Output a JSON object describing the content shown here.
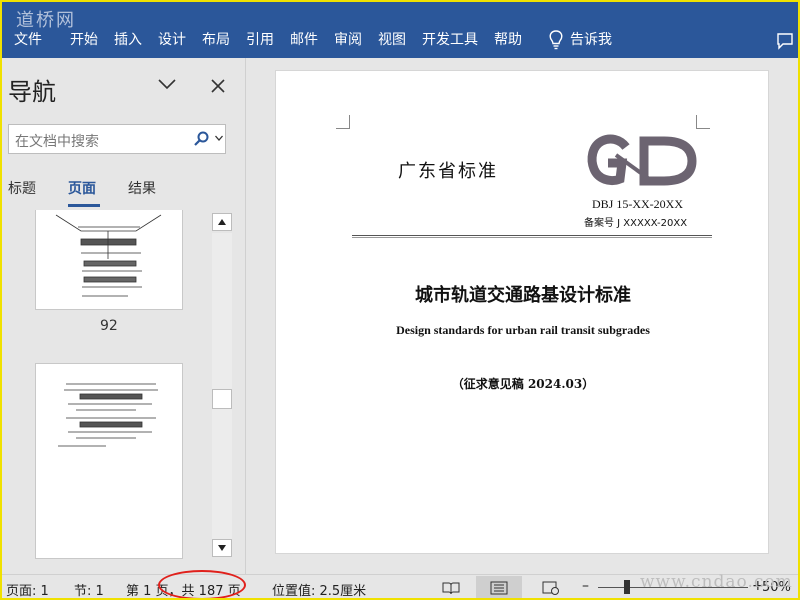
{
  "watermark": {
    "top": "道桥网",
    "bottom": "www.cndao.com"
  },
  "menu": {
    "items": [
      "文件",
      "开始",
      "插入",
      "设计",
      "布局",
      "引用",
      "邮件",
      "审阅",
      "视图",
      "开发工具",
      "帮助"
    ],
    "tell": "告诉我"
  },
  "nav": {
    "title": "导航",
    "search_placeholder": "在文档中搜索",
    "tabs": [
      "标题",
      "页面",
      "结果"
    ],
    "active_tab": "页面",
    "page_number": "92"
  },
  "document": {
    "org": "广东省标准",
    "logo": "GD",
    "doc_number": "DBJ 15-XX-20XX",
    "record_number": "备案号 J XXXXX-20XX",
    "title_cn": "城市轨道交通路基设计标准",
    "title_en": "Design standards for urban rail transit subgrades",
    "draft": "（征求意见稿 2024.03）"
  },
  "status": {
    "page": "页面: 1",
    "section": "节: 1",
    "page_of": "第 1 页，共 187 页",
    "position": "位置值: 2.5厘米",
    "zoom": "50%"
  },
  "colors": {
    "ribbon": "#2b579a",
    "highlight_oval": "#e0201b",
    "frame": "#f0e100"
  }
}
